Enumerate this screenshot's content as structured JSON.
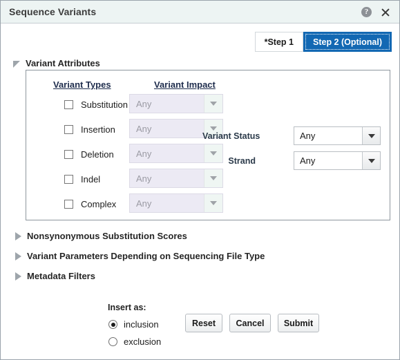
{
  "window": {
    "title": "Sequence Variants",
    "help_icon": "help-circle-icon",
    "close_icon": "close-icon"
  },
  "steps": [
    {
      "label": "*Step 1",
      "active": false
    },
    {
      "label": "Step 2 (Optional)",
      "active": true
    }
  ],
  "sections": [
    {
      "title": "Variant Attributes",
      "expanded": true
    },
    {
      "title": "Nonsynonymous Substitution Scores",
      "expanded": false
    },
    {
      "title": "Variant Parameters Depending on Sequencing File Type",
      "expanded": false
    },
    {
      "title": "Metadata Filters",
      "expanded": false
    }
  ],
  "variant_attributes": {
    "col_headers": {
      "types": "Variant Types",
      "impact": "Variant Impact"
    },
    "rows": [
      {
        "label": "Substitution",
        "checked": false,
        "impact": "Any",
        "impact_enabled": false
      },
      {
        "label": "Insertion",
        "checked": false,
        "impact": "Any",
        "impact_enabled": false
      },
      {
        "label": "Deletion",
        "checked": false,
        "impact": "Any",
        "impact_enabled": false
      },
      {
        "label": "Indel",
        "checked": false,
        "impact": "Any",
        "impact_enabled": false
      },
      {
        "label": "Complex",
        "checked": false,
        "impact": "Any",
        "impact_enabled": false
      }
    ],
    "side_fields": [
      {
        "label": "Variant Status",
        "value": "Any"
      },
      {
        "label": "Strand",
        "value": "Any"
      }
    ]
  },
  "footer": {
    "insert_as_label": "Insert as:",
    "radios": [
      {
        "label": "inclusion",
        "selected": true
      },
      {
        "label": "exclusion",
        "selected": false
      }
    ],
    "buttons": [
      {
        "label": "Reset"
      },
      {
        "label": "Cancel"
      },
      {
        "label": "Submit"
      }
    ]
  },
  "colors": {
    "titlebar_bg": "#edf4f3",
    "active_tab": "#1268b3",
    "disabled_field": "#eceaf4",
    "header_text": "#1f2d4d"
  }
}
